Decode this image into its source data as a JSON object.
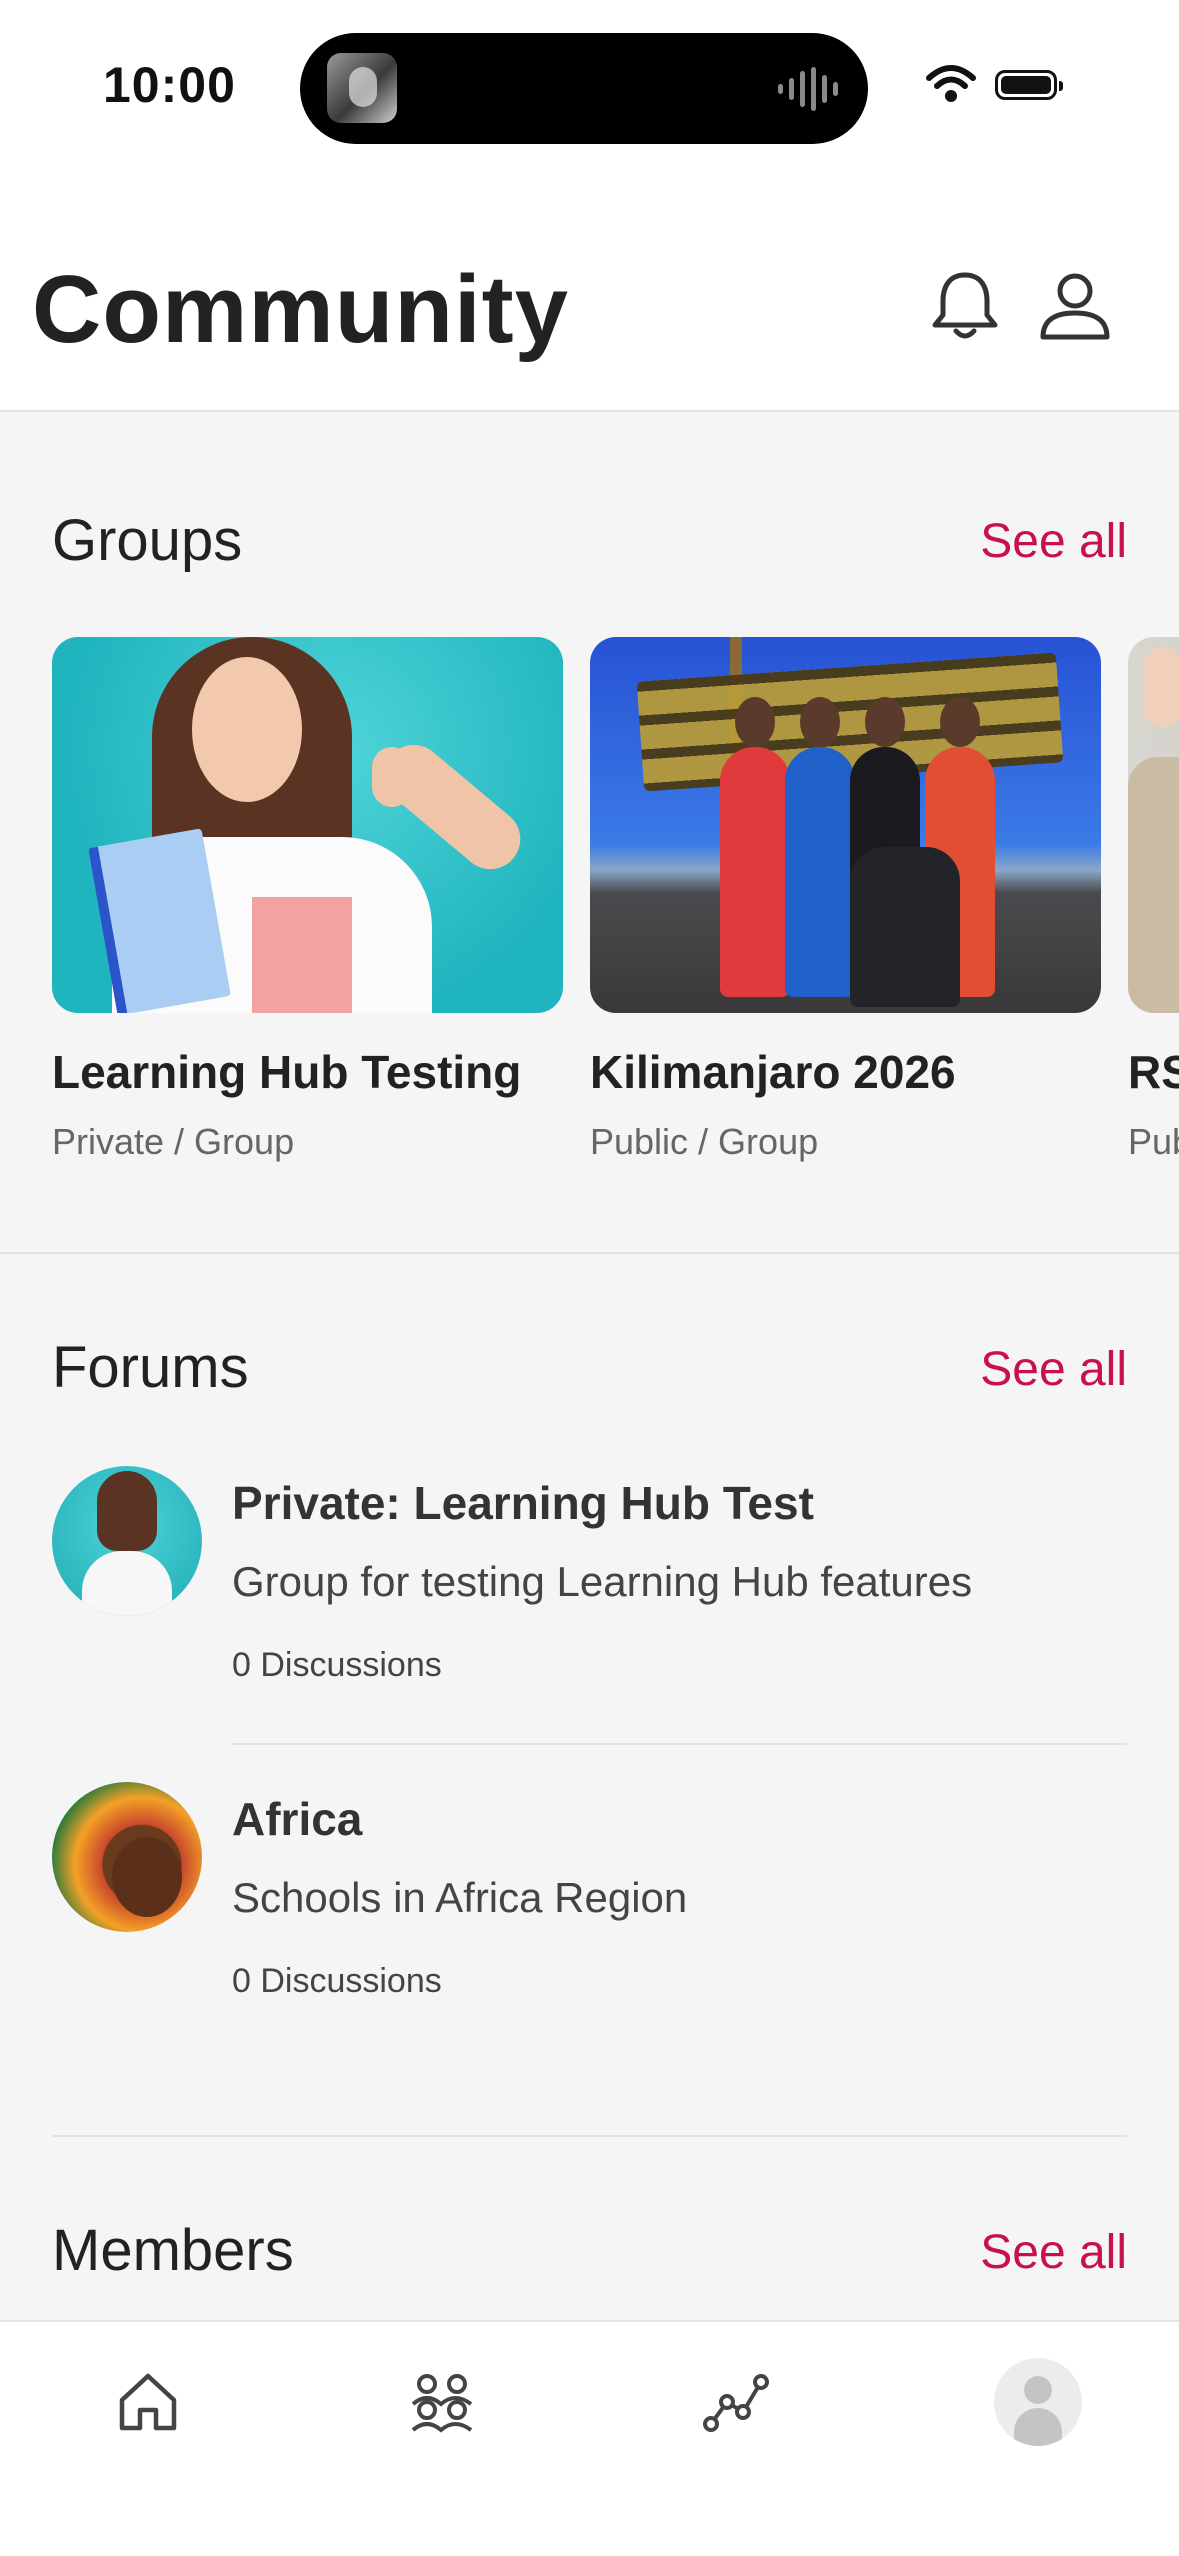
{
  "status_bar": {
    "time": "10:00"
  },
  "header": {
    "title": "Community"
  },
  "groups": {
    "title": "Groups",
    "see_all": "See all",
    "items": [
      {
        "name": "Learning Hub Testing",
        "meta": "Private / Group"
      },
      {
        "name": "Kilimanjaro 2026",
        "meta": "Public / Group"
      },
      {
        "name": "RS",
        "meta": "Pub"
      }
    ]
  },
  "forums": {
    "title": "Forums",
    "see_all": "See all",
    "items": [
      {
        "title": "Private: Learning Hub Test",
        "description": "Group for testing Learning Hub features",
        "count": "0 Discussions"
      },
      {
        "title": "Africa",
        "description": "Schools in Africa Region",
        "count": "0 Discussions"
      }
    ]
  },
  "members": {
    "title": "Members",
    "see_all": "See all"
  },
  "tab_bar": {
    "tabs": [
      "home-icon",
      "groups-icon",
      "activity-icon",
      "profile-avatar"
    ]
  },
  "colors": {
    "accent": "#c8104f",
    "background": "#f5f5f5",
    "text": "#222222"
  }
}
